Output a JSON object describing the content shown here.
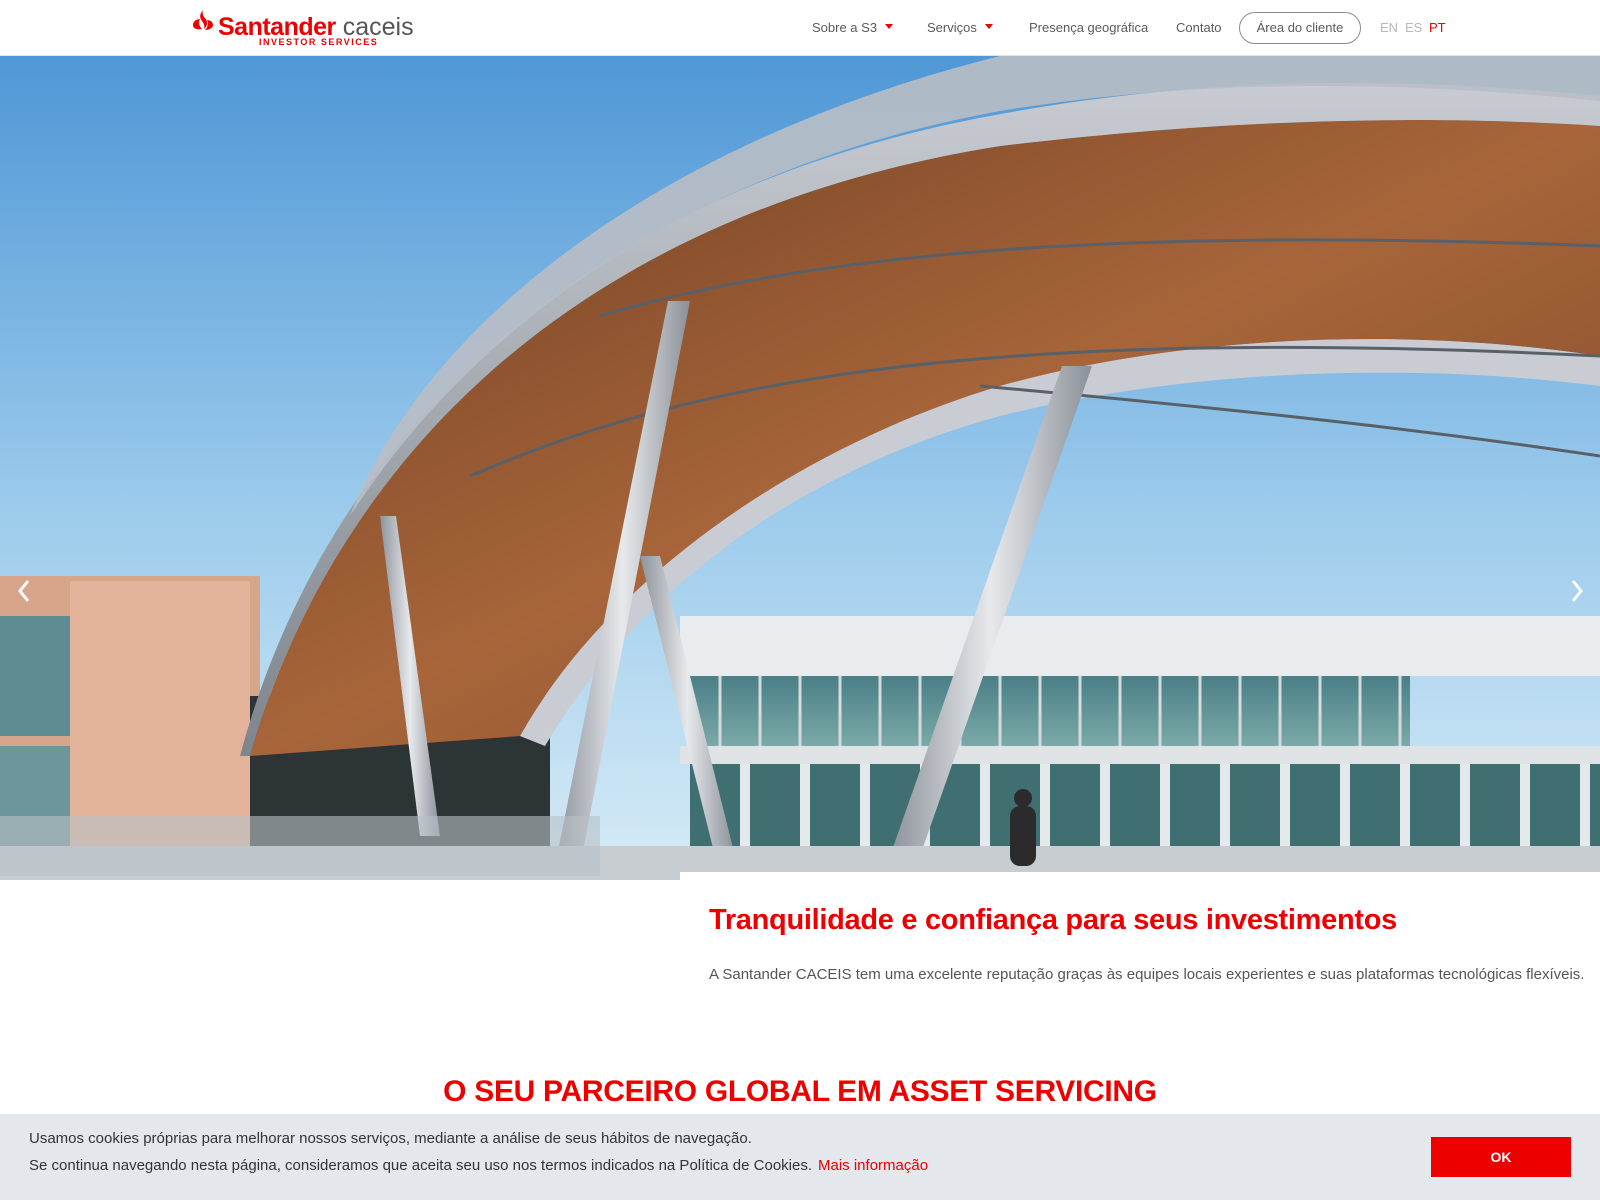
{
  "brand": {
    "name": "Santander",
    "name_suffix": " caceis",
    "tagline": "INVESTOR SERVICES",
    "color": "#ec0000"
  },
  "nav": {
    "items": [
      {
        "label": "Sobre a S3",
        "has_dropdown": true
      },
      {
        "label": "Serviços",
        "has_dropdown": true
      },
      {
        "label": "Presença geográfica",
        "has_dropdown": false
      },
      {
        "label": "Contato",
        "has_dropdown": false
      }
    ],
    "client_button": "Área do cliente",
    "languages": [
      "EN",
      "ES",
      "PT"
    ],
    "active_language": "PT"
  },
  "hero": {
    "prev_icon": "chevron-left-icon",
    "next_icon": "chevron-right-icon"
  },
  "content": {
    "headline": "Tranquilidade e confiança para seus investimentos",
    "lead": "A Santander CACEIS tem uma excelente reputação graças às equipes locais experientes e suas plataformas tecnológicas flexíveis.",
    "section_title": "O SEU PARCEIRO GLOBAL EM ASSET SERVICING"
  },
  "cookie": {
    "line1": "Usamos cookies próprias para melhorar nossos serviços, mediante a análise de seus hábitos de navegação.",
    "line2": "Se continua navegando nesta página, consideramos que aceita seu uso nos termos indicados na Política de Cookies.",
    "link": "Mais informação",
    "ok": "OK"
  }
}
